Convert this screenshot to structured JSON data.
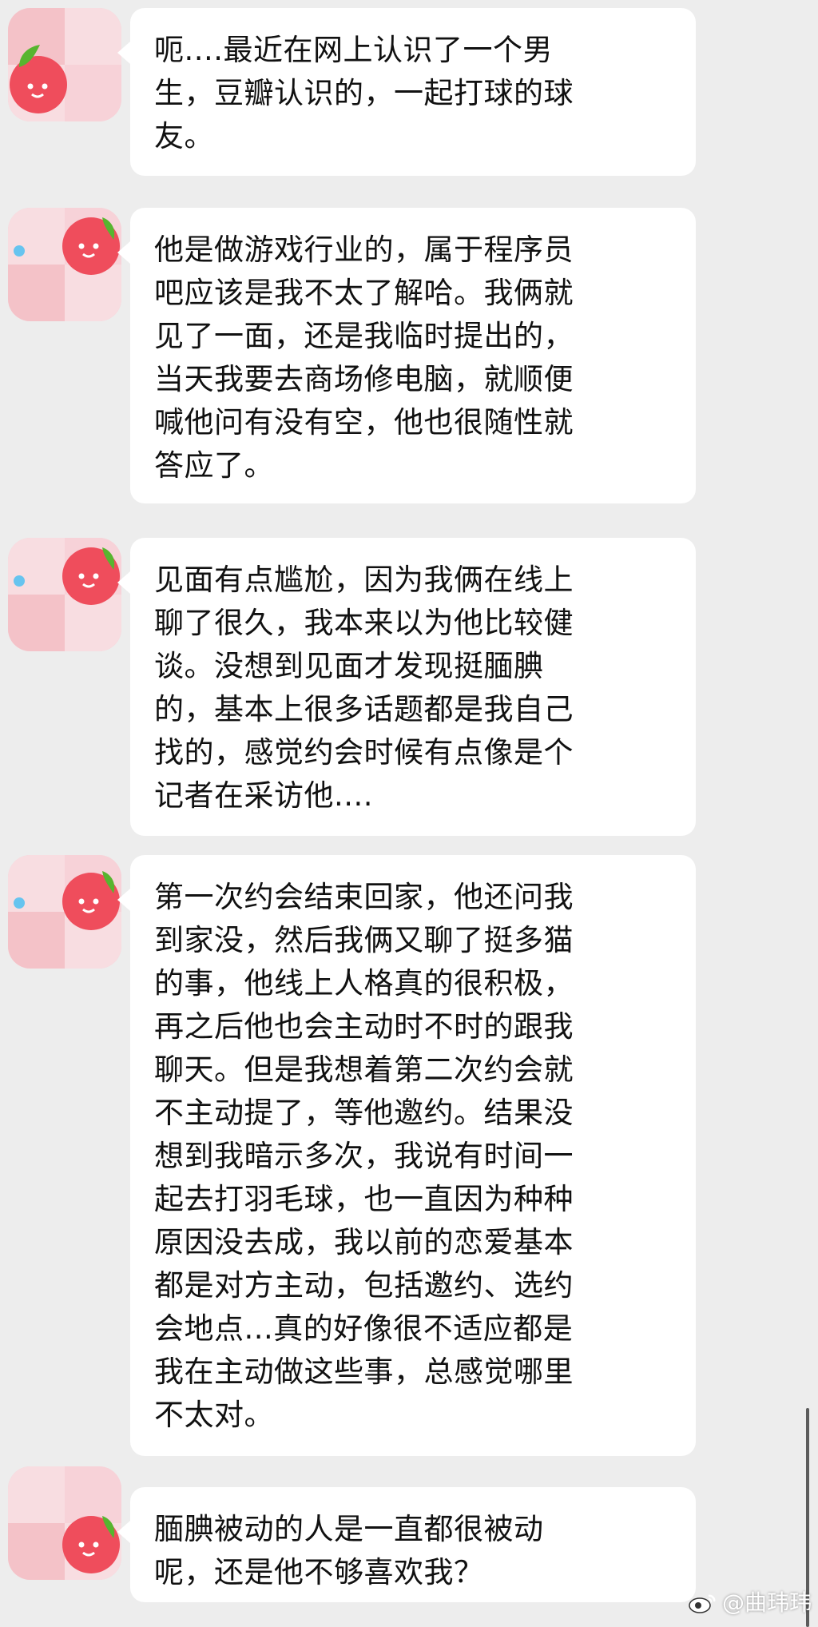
{
  "messages": [
    {
      "text": "呃....最近在网上认识了一个男\n生，豆瓣认识的，一起打球的球\n友。"
    },
    {
      "text": "他是做游戏行业的，属于程序员\n吧应该是我不太了解哈。我俩就\n见了一面，还是我临时提出的，\n当天我要去商场修电脑，就顺便\n喊他问有没有空，他也很随性就\n答应了。"
    },
    {
      "text": "见面有点尴尬，因为我俩在线上\n聊了很久，我本来以为他比较健\n谈。没想到见面才发现挺腼腆\n的，基本上很多话题都是我自己\n找的，感觉约会时候有点像是个\n记者在采访他...."
    },
    {
      "text": "第一次约会结束回家，他还问我\n到家没，然后我俩又聊了挺多猫\n的事，他线上人格真的很积极，\n再之后他也会主动时不时的跟我\n聊天。但是我想着第二次约会就\n不主动提了，等他邀约。结果没\n想到我暗示多次，我说有时间一\n起去打羽毛球，也一直因为种种\n原因没去成，我以前的恋爱基本\n都是对方主动，包括邀约、选约\n会地点...真的好像很不适应都是\n我在主动做这些事，总感觉哪里\n不太对。"
    },
    {
      "text": "腼腆被动的人是一直都很被动\n呢，还是他不够喜欢我？"
    }
  ],
  "watermark": {
    "text": "@曲玮玮",
    "icon": "weibo-logo-icon"
  },
  "colors": {
    "background": "#ededed",
    "bubble": "#ffffff",
    "text": "#111111",
    "avatar_pink": "#f3c9cf",
    "apple_red": "#ef4d5c",
    "leaf_green": "#57b52f"
  }
}
